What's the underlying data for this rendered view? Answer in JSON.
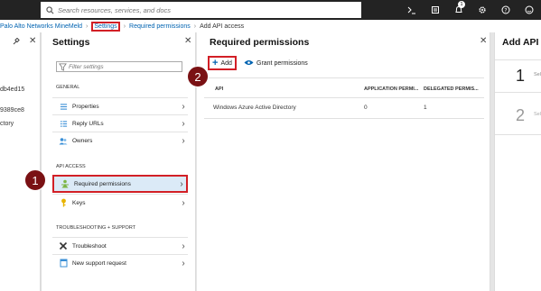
{
  "topbar": {
    "search_placeholder": "Search resources, services, and docs",
    "notification_count": "1",
    "icons": [
      "terminal-icon",
      "feedback-icon",
      "bell-icon",
      "gear-icon",
      "help-icon",
      "smiley-icon"
    ]
  },
  "breadcrumb": {
    "items": [
      "Palo Alto Networks MineMeld",
      "Settings",
      "Required permissions",
      "Add API access"
    ]
  },
  "blade1": {
    "partial_lines": [
      "db4ed15",
      "9389ce8",
      "ctory"
    ]
  },
  "settings": {
    "title": "Settings",
    "filter_placeholder": "Filter settings",
    "sections": {
      "general": "GENERAL",
      "api_access": "API ACCESS",
      "troubleshooting": "TROUBLESHOOTING + SUPPORT"
    },
    "general_items": [
      "Properties",
      "Reply URLs",
      "Owners"
    ],
    "api_items": [
      "Required permissions",
      "Keys"
    ],
    "support_items": [
      "Troubleshoot",
      "New support request"
    ]
  },
  "permissions": {
    "title": "Required permissions",
    "add_label": "Add",
    "grant_label": "Grant permissions",
    "columns": [
      "API",
      "APPLICATION PERMI...",
      "DELEGATED PERMIS..."
    ],
    "rows": [
      {
        "api": "Windows Azure Active Directory",
        "app": "0",
        "delegated": "1"
      }
    ]
  },
  "addapi": {
    "title": "Add API a",
    "steps": [
      "1",
      "2"
    ],
    "step_text": [
      "Sel",
      "Sel"
    ]
  },
  "callouts": [
    "1",
    "2"
  ],
  "colors": {
    "highlight": "#d21f26",
    "callout": "#7a1114",
    "link": "#0063b1",
    "selected": "#dbeaf7"
  }
}
